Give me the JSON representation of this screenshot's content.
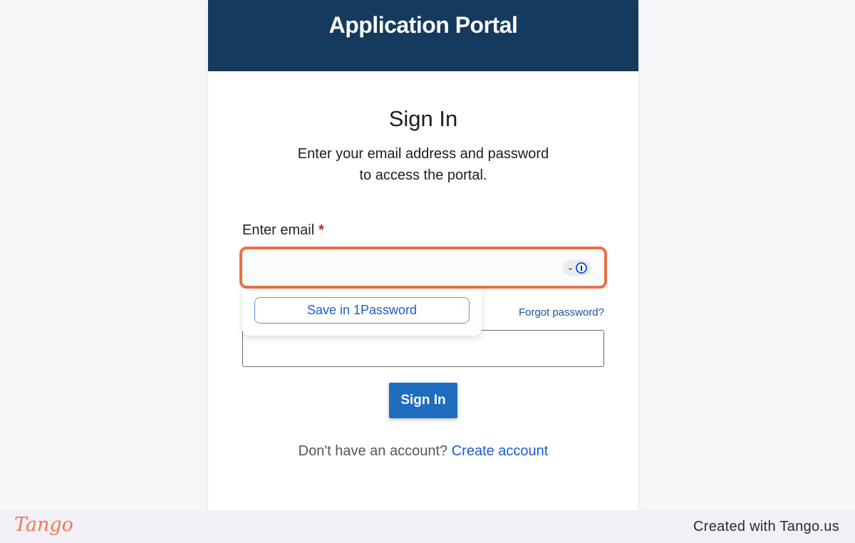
{
  "header": {
    "title": "Application Portal"
  },
  "form": {
    "title": "Sign In",
    "subtitle_line1": "Enter your email address and password",
    "subtitle_line2": "to access the portal.",
    "email_label": "Enter email",
    "required_marker": "*",
    "email_value": "",
    "forgot_password": "Forgot password?",
    "password_value": "",
    "signin_button": "Sign In",
    "no_account_text": "Don't have an account?",
    "create_account_link": "Create account"
  },
  "password_manager": {
    "save_button": "Save in 1Password",
    "icons": [
      "chevron-down-icon",
      "1password-icon"
    ]
  },
  "footer": {
    "logo": "Tango",
    "credit": "Created with Tango.us"
  },
  "colors": {
    "header_bg": "#143a5e",
    "highlight": "#ec6f45",
    "primary_button": "#1f6dbf",
    "link": "#1a5bd3"
  }
}
